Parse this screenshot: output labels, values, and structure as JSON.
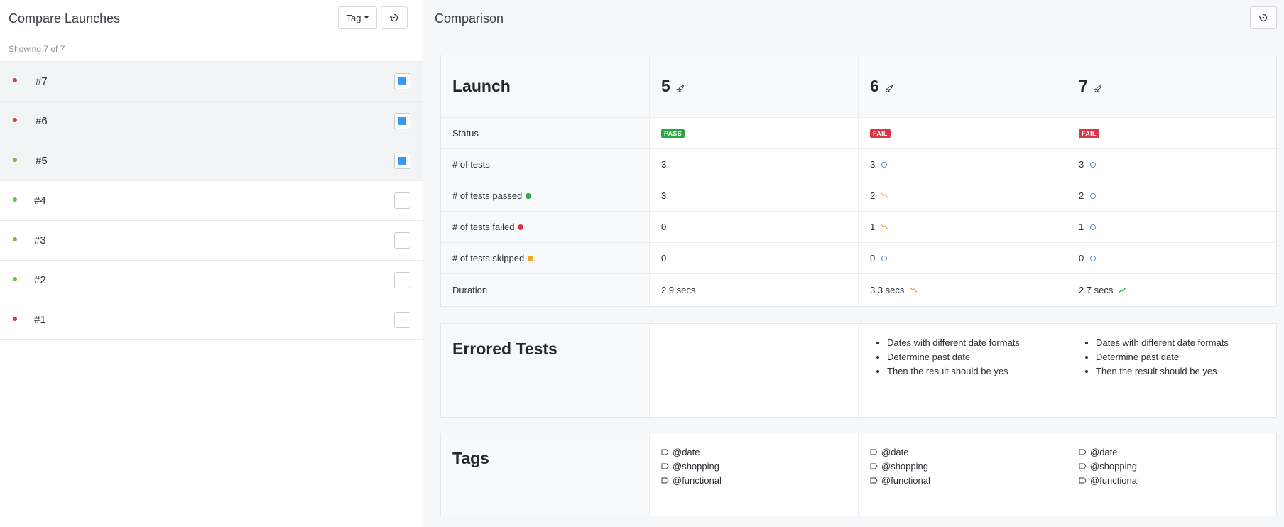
{
  "left": {
    "title": "Compare Launches",
    "tag_button": "Tag",
    "showing": "Showing 7 of 7",
    "launches": [
      {
        "label": "#7",
        "status_color": "#e0383e",
        "selected": true
      },
      {
        "label": "#6",
        "status_color": "#e0383e",
        "selected": true
      },
      {
        "label": "#5",
        "status_color": "#6cc04a",
        "selected": true
      },
      {
        "label": "#4",
        "status_color": "#6cc04a",
        "selected": false
      },
      {
        "label": "#3",
        "status_color": "#6cc04a",
        "selected": false
      },
      {
        "label": "#2",
        "status_color": "#6cc04a",
        "selected": false
      },
      {
        "label": "#1",
        "status_color": "#e0383e",
        "selected": false
      }
    ]
  },
  "right": {
    "title": "Comparison",
    "launch_label": "Launch",
    "columns": [
      {
        "launch": "5",
        "status": "PASS",
        "tests": "3",
        "tests_ind": "",
        "passed": "3",
        "passed_ind": "",
        "failed": "0",
        "failed_ind": "",
        "skipped": "0",
        "skipped_ind": "",
        "duration": "2.9 secs",
        "duration_ind": "",
        "errored": [],
        "tags": [
          "@date",
          "@shopping",
          "@functional"
        ]
      },
      {
        "launch": "6",
        "status": "FAIL",
        "tests": "3",
        "tests_ind": "same",
        "passed": "2",
        "passed_ind": "down",
        "failed": "1",
        "failed_ind": "down",
        "skipped": "0",
        "skipped_ind": "same",
        "duration": "3.3 secs",
        "duration_ind": "down",
        "errored": [
          "Dates with different date formats",
          "Determine past date",
          "Then the result should be yes"
        ],
        "tags": [
          "@date",
          "@shopping",
          "@functional"
        ]
      },
      {
        "launch": "7",
        "status": "FAIL",
        "tests": "3",
        "tests_ind": "same",
        "passed": "2",
        "passed_ind": "same",
        "failed": "1",
        "failed_ind": "same",
        "skipped": "0",
        "skipped_ind": "same",
        "duration": "2.7 secs",
        "duration_ind": "up",
        "errored": [
          "Dates with different date formats",
          "Determine past date",
          "Then the result should be yes"
        ],
        "tags": [
          "@date",
          "@shopping",
          "@functional"
        ]
      }
    ],
    "rows": [
      {
        "key": "status",
        "label": "Status",
        "dot": ""
      },
      {
        "key": "tests",
        "label": "# of tests",
        "dot": ""
      },
      {
        "key": "passed",
        "label": "# of tests passed",
        "dot": "#28a745"
      },
      {
        "key": "failed",
        "label": "# of tests failed",
        "dot": "#dc3545"
      },
      {
        "key": "skipped",
        "label": "# of tests skipped",
        "dot": "#f5a623"
      },
      {
        "key": "duration",
        "label": "Duration",
        "dot": ""
      }
    ],
    "errored_label": "Errored Tests",
    "tags_label": "Tags"
  },
  "colors": {
    "pass": "#28a745",
    "fail": "#dc3545",
    "trend_down": "#f5a03a",
    "trend_up": "#2eab4f",
    "same": "#4a90e2",
    "check": "#3b97f0"
  },
  "icons": [
    "reset-icon",
    "rocket-icon",
    "tag-icon",
    "trend-down-icon",
    "trend-up-icon",
    "unchanged-icon"
  ]
}
